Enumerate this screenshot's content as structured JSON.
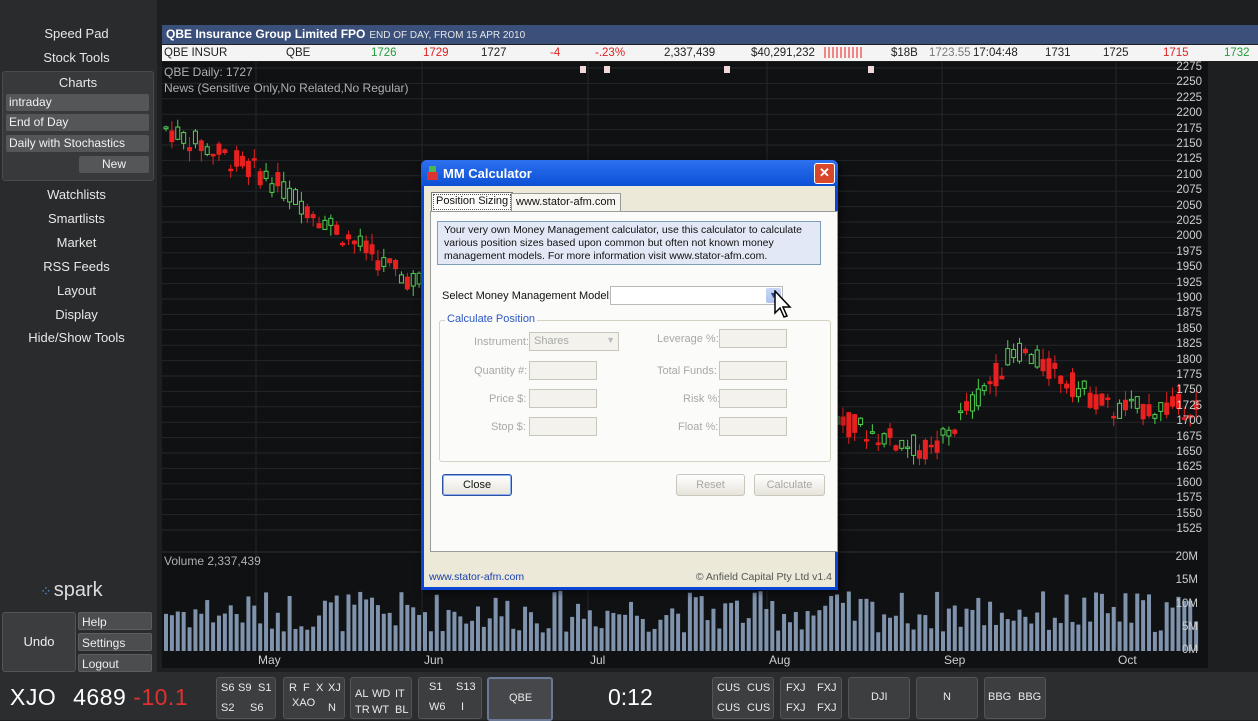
{
  "sidebar": {
    "items_top": [
      "Speed Pad",
      "Stock Tools"
    ],
    "charts_label": "Charts",
    "charts_sub": [
      "intraday",
      "End of Day",
      "Daily with Stochastics"
    ],
    "new_label": "New",
    "items": [
      "Watchlists",
      "Smartlists",
      "Market",
      "RSS Feeds",
      "Layout",
      "Display",
      "Hide/Show Tools"
    ],
    "brand": "spark",
    "undo": "Undo",
    "help": "Help",
    "settings": "Settings",
    "logout": "Logout"
  },
  "header": {
    "title": "QBE Insurance Group Limited FPO",
    "subtitle": "END OF DAY, FROM 15 APR 2010"
  },
  "quote": {
    "name": "QBE INSUR",
    "code": "QBE",
    "bid": "1726",
    "ask": "1729",
    "last": "1727",
    "change": "-4",
    "change_pct": "-.23%",
    "volume": "2,337,439",
    "value": "$40,291,232",
    "mkt_cap": "$18B",
    "vwap": "1723.55",
    "time": "17:04:48",
    "open": "1731",
    "low": "1725",
    "prev": "1715",
    "high": "1732"
  },
  "chart": {
    "price_label": "QBE Daily: 1727",
    "news_label": "News (Sensitive Only,No Related,No Regular)",
    "volume_label": "Volume 2,337,439",
    "price_ticks": [
      "2275",
      "2250",
      "2225",
      "2200",
      "2175",
      "2150",
      "2125",
      "2100",
      "2075",
      "2050",
      "2025",
      "2000",
      "1975",
      "1950",
      "1925",
      "1900",
      "1875",
      "1850",
      "1825",
      "1800",
      "1775",
      "1750",
      "1725",
      "1700",
      "1675",
      "1650",
      "1625",
      "1600",
      "1575",
      "1550",
      "1525"
    ],
    "volume_ticks": [
      "20M",
      "15M",
      "10M",
      "5M",
      "0M"
    ],
    "months": [
      "May",
      "Jun",
      "Jul",
      "Aug",
      "Sep",
      "Oct"
    ],
    "up_color": "#4fd14f",
    "down_color": "#e82020",
    "volume_color": "#7f93ad"
  },
  "chart_data": {
    "type": "candlestick",
    "title": "QBE Daily: 1727",
    "ylabel": "",
    "ylim": [
      1510,
      2285
    ],
    "approx_close_path": [
      {
        "month": "Apr",
        "close": 2180
      },
      {
        "month": "May",
        "close": 2100
      },
      {
        "month": "May-end",
        "close": 1940
      },
      {
        "month": "Aug",
        "close": 1700
      },
      {
        "month": "Sep",
        "close": 1650
      },
      {
        "month": "Sep-mid",
        "close": 1820
      },
      {
        "month": "Oct",
        "close": 1720
      },
      {
        "month": "Oct-end",
        "close": 1727
      }
    ],
    "volume_ylim_millions": [
      0,
      20
    ]
  },
  "dialog": {
    "title": "MM Calculator",
    "tabs": [
      "Position Sizing",
      "www.stator-afm.com"
    ],
    "description": "Your very own Money Management calculator, use this calculator to calculate various position sizes based upon common but often not known money management models. For more information visit www.stator-afm.com.",
    "model_label": "Select Money Management Model:",
    "group_label": "Calculate Position",
    "instrument_label": "Instrument:",
    "instrument_value": "Shares",
    "quantity_label": "Quantity #:",
    "price_label": "Price $:",
    "stop_label": "Stop $:",
    "leverage_label": "Leverage %:",
    "funds_label": "Total Funds:",
    "risk_label": "Risk %:",
    "float_label": "Float %:",
    "close": "Close",
    "reset": "Reset",
    "calculate": "Calculate",
    "footer_link": "www.stator-afm.com",
    "footer_copy": "© Anfield Capital Pty Ltd v1.4"
  },
  "bottom": {
    "index": "XJO",
    "index_value": "4689",
    "index_change": "-10.1",
    "g1": [
      "S6",
      "S9",
      "S1",
      "S2",
      "S6"
    ],
    "g2": [
      "R",
      "F",
      "X",
      "XJ",
      "XAO",
      "N"
    ],
    "g3": [
      "AL",
      "WD",
      "IT",
      "TR",
      "WT",
      "BL"
    ],
    "g4": [
      "S1",
      "S13",
      "W6",
      "I"
    ],
    "g5": "QBE",
    "timer": "0:12",
    "g6": [
      "CUS",
      "CUS",
      "CUS",
      "CUS"
    ],
    "g7": [
      "FXJ",
      "FXJ",
      "FXJ",
      "FXJ"
    ],
    "g8": "DJI",
    "g9": "N",
    "g10": [
      "BBG",
      "BBG"
    ]
  }
}
